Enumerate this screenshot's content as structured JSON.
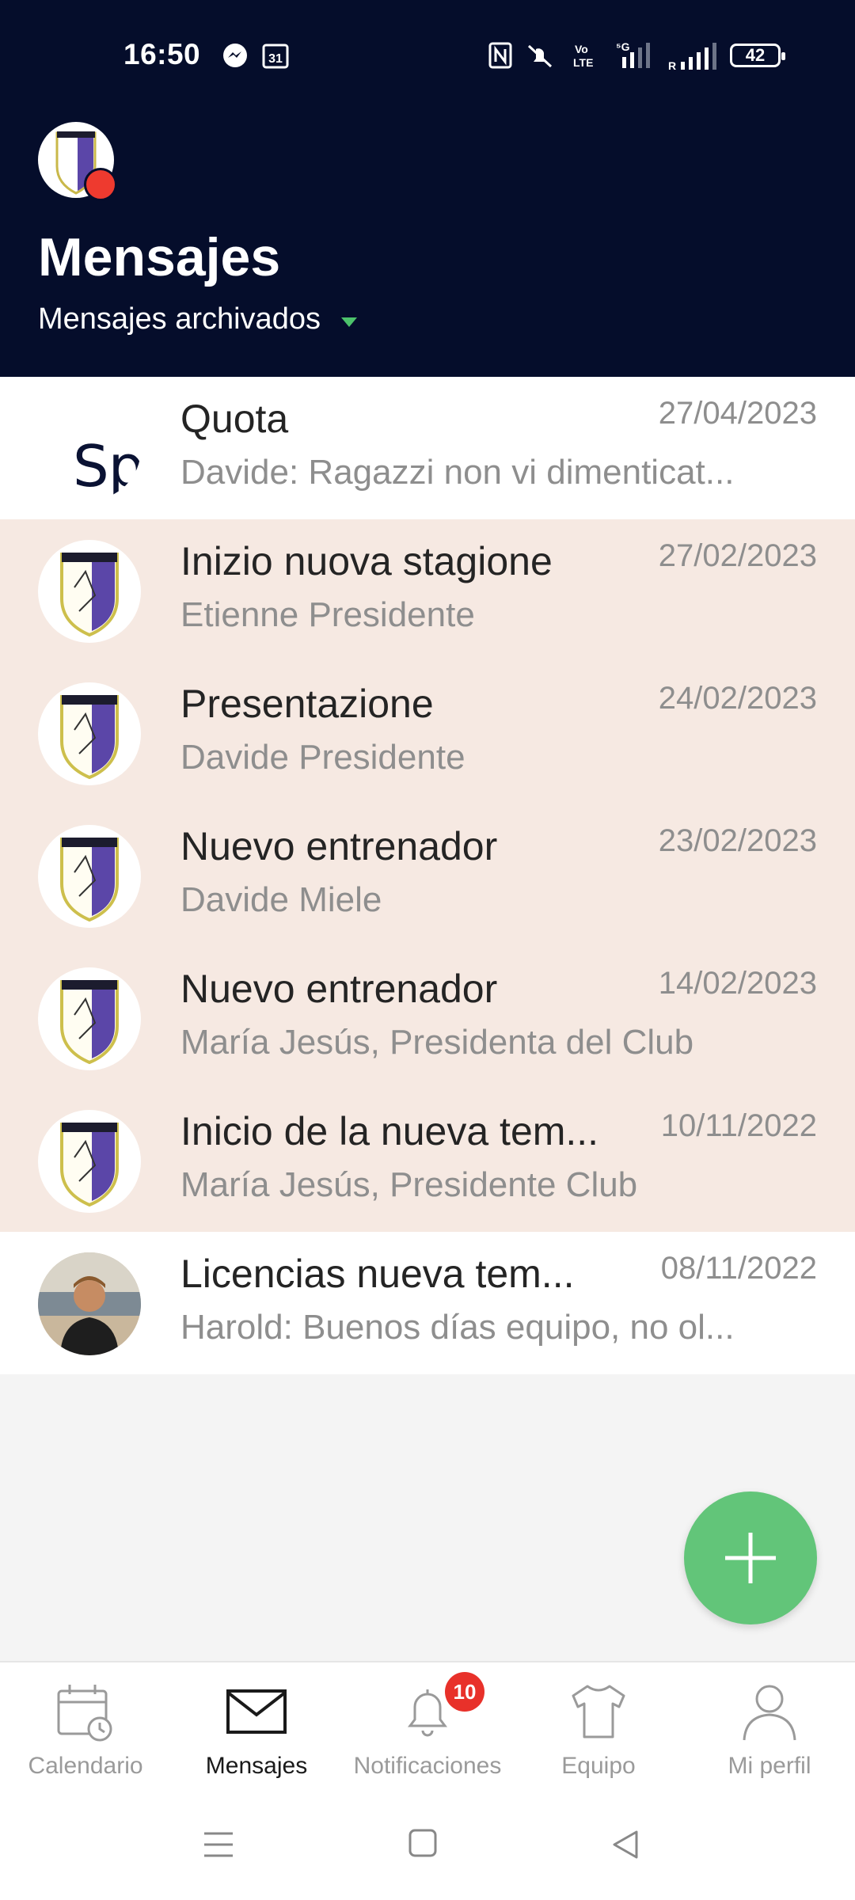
{
  "status_bar": {
    "time": "16:50",
    "battery": "42"
  },
  "header": {
    "title": "Mensajes",
    "filter_label": "Mensajes archivados"
  },
  "conversations": [
    {
      "title": "Quota",
      "subtitle": "Davide: Ragazzi non vi dimenticat...",
      "date": "27/04/2023",
      "avatar": "Spo",
      "highlight": false
    },
    {
      "title": "Inizio nuova stagione",
      "subtitle": "Etienne Presidente",
      "date": "27/02/2023",
      "avatar": "club-crest-icon",
      "highlight": true
    },
    {
      "title": "Presentazione",
      "subtitle": "Davide Presidente",
      "date": "24/02/2023",
      "avatar": "club-crest-icon",
      "highlight": true
    },
    {
      "title": "Nuevo entrenador",
      "subtitle": "Davide Miele",
      "date": "23/02/2023",
      "avatar": "club-crest-icon",
      "highlight": true
    },
    {
      "title": "Nuevo entrenador",
      "subtitle": "María Jesús, Presidenta del Club",
      "date": "14/02/2023",
      "avatar": "club-crest-icon",
      "highlight": true
    },
    {
      "title": "Inicio de la nueva tem...",
      "subtitle": "María Jesús, Presidente Club",
      "date": "10/11/2022",
      "avatar": "club-crest-icon",
      "highlight": true
    },
    {
      "title": "Licencias nueva tem...",
      "subtitle": "Harold: Buenos días equipo, no ol...",
      "date": "08/11/2022",
      "avatar": "user-photo",
      "highlight": false
    }
  ],
  "bottom_nav": [
    {
      "label": "Calendario",
      "icon": "calendar-icon",
      "active": false
    },
    {
      "label": "Mensajes",
      "icon": "envelope-icon",
      "active": true
    },
    {
      "label": "Notificaciones",
      "icon": "bell-icon",
      "active": false,
      "badge": "10"
    },
    {
      "label": "Equipo",
      "icon": "shirt-icon",
      "active": false
    },
    {
      "label": "Mi perfil",
      "icon": "person-icon",
      "active": false
    }
  ],
  "colors": {
    "header_bg": "#050d2b",
    "accent_green": "#62c579",
    "highlight_row": "#f6e9e2",
    "badge_red": "#e8312a"
  }
}
